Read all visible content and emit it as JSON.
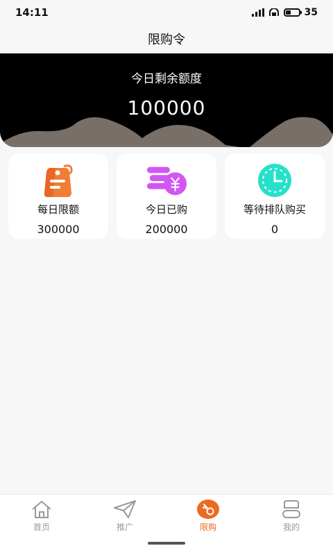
{
  "status_bar": {
    "time": "14:11",
    "battery": "35"
  },
  "header": {
    "title": "限购令"
  },
  "hero": {
    "label": "今日剩余额度",
    "value": "100000"
  },
  "cards": [
    {
      "title": "每日限额",
      "value": "300000",
      "icon": "price-tag-icon"
    },
    {
      "title": "今日已购",
      "value": "200000",
      "icon": "coins-yuan-icon"
    },
    {
      "title": "等待排队购买",
      "value": "0",
      "icon": "clock-icon"
    }
  ],
  "tabbar": {
    "items": [
      {
        "label": "首页",
        "icon": "home-icon"
      },
      {
        "label": "推广",
        "icon": "paper-plane-icon"
      },
      {
        "label": "限购",
        "icon": "key-icon",
        "active": true
      },
      {
        "label": "我的",
        "icon": "user-icon"
      }
    ]
  },
  "colors": {
    "accent": "#ec6a22",
    "purple": "#d257f2",
    "teal": "#25e1c9",
    "orange": "#f07d36"
  }
}
